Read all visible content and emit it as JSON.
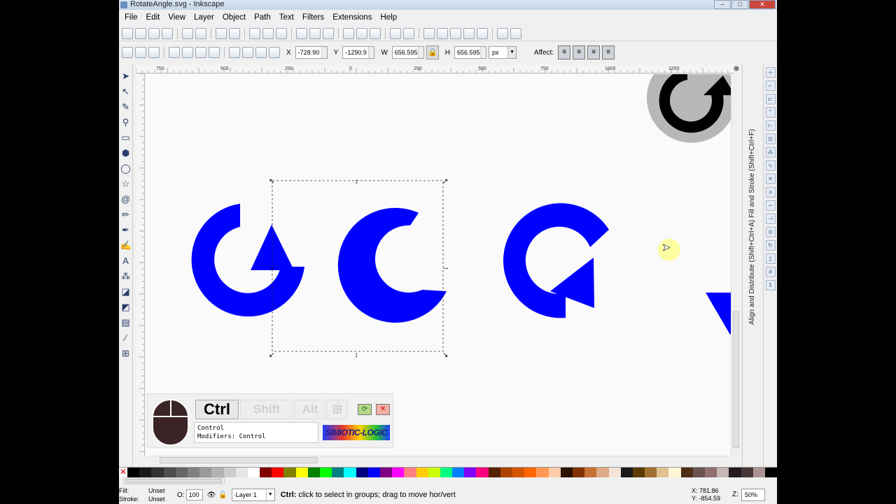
{
  "window": {
    "title": "RotateAngle.svg - Inkscape",
    "buttons": [
      "–",
      "□",
      "✕"
    ]
  },
  "menu": [
    "File",
    "Edit",
    "View",
    "Layer",
    "Object",
    "Path",
    "Text",
    "Filters",
    "Extensions",
    "Help"
  ],
  "controls": {
    "x_label": "X",
    "x_value": "-728.90",
    "y_label": "Y",
    "y_value": "-1290.9",
    "w_label": "W",
    "w_value": "656.595",
    "h_label": "H",
    "h_value": "656.595",
    "unit": "px",
    "affect_label": "Affect:"
  },
  "ruler_h_labels": [
    "750",
    "500",
    "250",
    "0",
    "250",
    "500",
    "750",
    "1000",
    "1250"
  ],
  "dock_tab": "Align and Distribute (Shift+Ctrl+A)   Fill and Stroke (Shift+Ctrl+F)",
  "status": {
    "fill_label": "Fill:",
    "fill_value": "Unset",
    "stroke_label": "Stroke:",
    "stroke_value": "Unset",
    "opacity_label": "O:",
    "opacity_value": "100",
    "layer": "·Layer 1",
    "message_key": "Ctrl:",
    "message": "click to select in groups; drag to move hor/vert",
    "coords_x": "X: 781.86",
    "coords_y": "Y: -854.59",
    "zoom_label": "Z:",
    "zoom": "50%"
  },
  "key_overlay": {
    "key_active": "Ctrl",
    "key_shift": "Shift",
    "key_alt": "Alt",
    "key_win": "⊞",
    "log_line1": "Control",
    "log_line2": "Modifiers: Control",
    "brand": "SIMIOTIC-LOGIC"
  },
  "colors": {
    "arrow_fill": "#0000ff",
    "canvas": "#fafafa"
  },
  "palette": [
    "#000000",
    "#1a1a1a",
    "#333333",
    "#4d4d4d",
    "#666666",
    "#808080",
    "#999999",
    "#b3b3b3",
    "#cccccc",
    "#e6e6e6",
    "#ffffff",
    "#800000",
    "#ff0000",
    "#808000",
    "#ffff00",
    "#008000",
    "#00ff00",
    "#008080",
    "#00ffff",
    "#000080",
    "#0000ff",
    "#800080",
    "#ff00ff",
    "#ff8080",
    "#ffcc00",
    "#ccff00",
    "#00ff80",
    "#0080ff",
    "#8000ff",
    "#ff0080",
    "#552200",
    "#aa4400",
    "#d45500",
    "#ff6600",
    "#ff9955",
    "#ffccaa",
    "#2b1100",
    "#803300",
    "#c87137",
    "#deaa87",
    "#f4e3d7",
    "#1a1a1a",
    "#5a3a00",
    "#a07030",
    "#e0c090",
    "#fff6d5",
    "#502d16",
    "#6c5353",
    "#916f6f",
    "#c8b7b7",
    "#241c1c",
    "#483737",
    "#ac9393",
    "#000000"
  ]
}
